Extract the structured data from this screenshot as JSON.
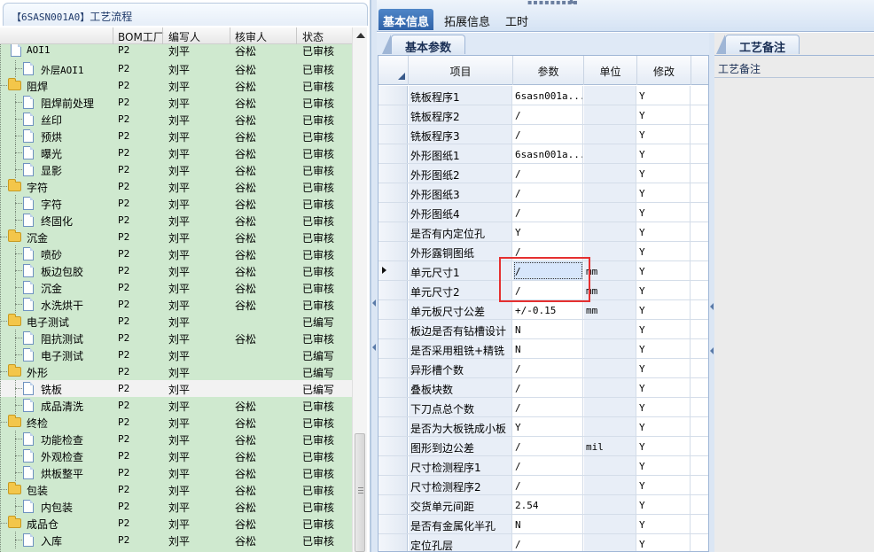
{
  "left_panel": {
    "title_code": "【6SASN001A0】",
    "title_text": "工艺流程",
    "columns": [
      "BOM工厂",
      "编写人",
      "核审人",
      "状态"
    ],
    "rows": [
      {
        "type": "doc",
        "depth": 1,
        "name": "外层AOI1",
        "bom": "P2",
        "writer": "刘平",
        "reviewer": "谷松",
        "status": "已审核",
        "mono": true
      },
      {
        "type": "folder",
        "depth": 0,
        "name": "阻焊",
        "bom": "P2",
        "writer": "刘平",
        "reviewer": "谷松",
        "status": "已审核"
      },
      {
        "type": "doc",
        "depth": 1,
        "name": "阻焊前处理",
        "bom": "P2",
        "writer": "刘平",
        "reviewer": "谷松",
        "status": "已审核"
      },
      {
        "type": "doc",
        "depth": 1,
        "name": "丝印",
        "bom": "P2",
        "writer": "刘平",
        "reviewer": "谷松",
        "status": "已审核"
      },
      {
        "type": "doc",
        "depth": 1,
        "name": "预烘",
        "bom": "P2",
        "writer": "刘平",
        "reviewer": "谷松",
        "status": "已审核"
      },
      {
        "type": "doc",
        "depth": 1,
        "name": "曝光",
        "bom": "P2",
        "writer": "刘平",
        "reviewer": "谷松",
        "status": "已审核"
      },
      {
        "type": "doc",
        "depth": 1,
        "name": "显影",
        "bom": "P2",
        "writer": "刘平",
        "reviewer": "谷松",
        "status": "已审核"
      },
      {
        "type": "folder",
        "depth": 0,
        "name": "字符",
        "bom": "P2",
        "writer": "刘平",
        "reviewer": "谷松",
        "status": "已审核"
      },
      {
        "type": "doc",
        "depth": 1,
        "name": "字符",
        "bom": "P2",
        "writer": "刘平",
        "reviewer": "谷松",
        "status": "已审核"
      },
      {
        "type": "doc",
        "depth": 1,
        "name": "终固化",
        "bom": "P2",
        "writer": "刘平",
        "reviewer": "谷松",
        "status": "已审核"
      },
      {
        "type": "folder",
        "depth": 0,
        "name": "沉金",
        "bom": "P2",
        "writer": "刘平",
        "reviewer": "谷松",
        "status": "已审核"
      },
      {
        "type": "doc",
        "depth": 1,
        "name": "喷砂",
        "bom": "P2",
        "writer": "刘平",
        "reviewer": "谷松",
        "status": "已审核"
      },
      {
        "type": "doc",
        "depth": 1,
        "name": "板边包胶",
        "bom": "P2",
        "writer": "刘平",
        "reviewer": "谷松",
        "status": "已审核"
      },
      {
        "type": "doc",
        "depth": 1,
        "name": "沉金",
        "bom": "P2",
        "writer": "刘平",
        "reviewer": "谷松",
        "status": "已审核"
      },
      {
        "type": "doc",
        "depth": 1,
        "name": "水洗烘干",
        "bom": "P2",
        "writer": "刘平",
        "reviewer": "谷松",
        "status": "已审核"
      },
      {
        "type": "folder",
        "depth": 0,
        "name": "电子测试",
        "bom": "P2",
        "writer": "刘平",
        "reviewer": "",
        "status": "已编写"
      },
      {
        "type": "doc",
        "depth": 1,
        "name": "阻抗测试",
        "bom": "P2",
        "writer": "刘平",
        "reviewer": "谷松",
        "status": "已审核"
      },
      {
        "type": "doc",
        "depth": 1,
        "name": "电子测试",
        "bom": "P2",
        "writer": "刘平",
        "reviewer": "",
        "status": "已编写"
      },
      {
        "type": "folder",
        "depth": 0,
        "name": "外形",
        "bom": "P2",
        "writer": "刘平",
        "reviewer": "",
        "status": "已编写"
      },
      {
        "type": "doc",
        "depth": 1,
        "name": "铣板",
        "bom": "P2",
        "writer": "刘平",
        "reviewer": "",
        "status": "已编写",
        "selected": true
      },
      {
        "type": "doc",
        "depth": 1,
        "name": "成品清洗",
        "bom": "P2",
        "writer": "刘平",
        "reviewer": "谷松",
        "status": "已审核"
      },
      {
        "type": "folder",
        "depth": 0,
        "name": "终检",
        "bom": "P2",
        "writer": "刘平",
        "reviewer": "谷松",
        "status": "已审核"
      },
      {
        "type": "doc",
        "depth": 1,
        "name": "功能检查",
        "bom": "P2",
        "writer": "刘平",
        "reviewer": "谷松",
        "status": "已审核"
      },
      {
        "type": "doc",
        "depth": 1,
        "name": "外观检查",
        "bom": "P2",
        "writer": "刘平",
        "reviewer": "谷松",
        "status": "已审核"
      },
      {
        "type": "doc",
        "depth": 1,
        "name": "烘板整平",
        "bom": "P2",
        "writer": "刘平",
        "reviewer": "谷松",
        "status": "已审核"
      },
      {
        "type": "folder",
        "depth": 0,
        "name": "包装",
        "bom": "P2",
        "writer": "刘平",
        "reviewer": "谷松",
        "status": "已审核"
      },
      {
        "type": "doc",
        "depth": 1,
        "name": "内包装",
        "bom": "P2",
        "writer": "刘平",
        "reviewer": "谷松",
        "status": "已审核"
      },
      {
        "type": "folder",
        "depth": 0,
        "name": "成品仓",
        "bom": "P2",
        "writer": "刘平",
        "reviewer": "谷松",
        "status": "已审核"
      },
      {
        "type": "doc",
        "depth": 1,
        "name": "入库",
        "bom": "P2",
        "writer": "刘平",
        "reviewer": "谷松",
        "status": "已审核"
      }
    ],
    "top_partial_row": {
      "name": "AOI1",
      "bom": "P2",
      "writer": "刘平",
      "reviewer": "谷松",
      "status": "已审核"
    }
  },
  "top_tabs": [
    "基本信息",
    "拓展信息",
    "工时"
  ],
  "sub_tab": "基本参数",
  "right_tab": "工艺备注",
  "right_label": "工艺备注",
  "grid": {
    "columns": [
      "项目",
      "参数",
      "单位",
      "修改"
    ],
    "rows": [
      {
        "item": "铣板程序1",
        "param": "6sasn001a...",
        "unit": "",
        "mod": "Y"
      },
      {
        "item": "铣板程序2",
        "param": "/",
        "unit": "",
        "mod": "Y"
      },
      {
        "item": "铣板程序3",
        "param": "/",
        "unit": "",
        "mod": "Y"
      },
      {
        "item": "外形图纸1",
        "param": "6sasn001a...",
        "unit": "",
        "mod": "Y"
      },
      {
        "item": "外形图纸2",
        "param": "/",
        "unit": "",
        "mod": "Y"
      },
      {
        "item": "外形图纸3",
        "param": "/",
        "unit": "",
        "mod": "Y"
      },
      {
        "item": "外形图纸4",
        "param": "/",
        "unit": "",
        "mod": "Y"
      },
      {
        "item": "是否有内定位孔",
        "param": "Y",
        "unit": "",
        "mod": "Y"
      },
      {
        "item": "外形露铜图纸",
        "param": "/",
        "unit": "",
        "mod": "Y"
      },
      {
        "item": "单元尺寸1",
        "param": "/",
        "unit": "mm",
        "mod": "Y",
        "current": true
      },
      {
        "item": "单元尺寸2",
        "param": "/",
        "unit": "mm",
        "mod": "Y"
      },
      {
        "item": "单元板尺寸公差",
        "param": "+/-0.15",
        "unit": "mm",
        "mod": "Y"
      },
      {
        "item": "板边是否有钻槽设计",
        "param": "N",
        "unit": "",
        "mod": "Y"
      },
      {
        "item": "是否采用粗铣+精铣",
        "param": "N",
        "unit": "",
        "mod": "Y"
      },
      {
        "item": "异形槽个数",
        "param": "/",
        "unit": "",
        "mod": "Y"
      },
      {
        "item": "叠板块数",
        "param": "/",
        "unit": "",
        "mod": "Y"
      },
      {
        "item": "下刀点总个数",
        "param": "/",
        "unit": "",
        "mod": "Y"
      },
      {
        "item": "是否为大板铣成小板",
        "param": "Y",
        "unit": "",
        "mod": "Y"
      },
      {
        "item": "图形到边公差",
        "param": "/",
        "unit": "mil",
        "mod": "Y"
      },
      {
        "item": "尺寸检测程序1",
        "param": "/",
        "unit": "",
        "mod": "Y"
      },
      {
        "item": "尺寸检测程序2",
        "param": "/",
        "unit": "",
        "mod": "Y"
      },
      {
        "item": "交货单元间距",
        "param": "2.54",
        "unit": "",
        "mod": "Y"
      },
      {
        "item": "是否有金属化半孔",
        "param": "N",
        "unit": "",
        "mod": "Y"
      },
      {
        "item": "定位孔层",
        "param": "/",
        "unit": "",
        "mod": "Y"
      }
    ]
  },
  "colors": {
    "tree_bg": "#cfe9cf",
    "accent_tab": "#2f62a8",
    "highlight_box": "#e53030"
  }
}
